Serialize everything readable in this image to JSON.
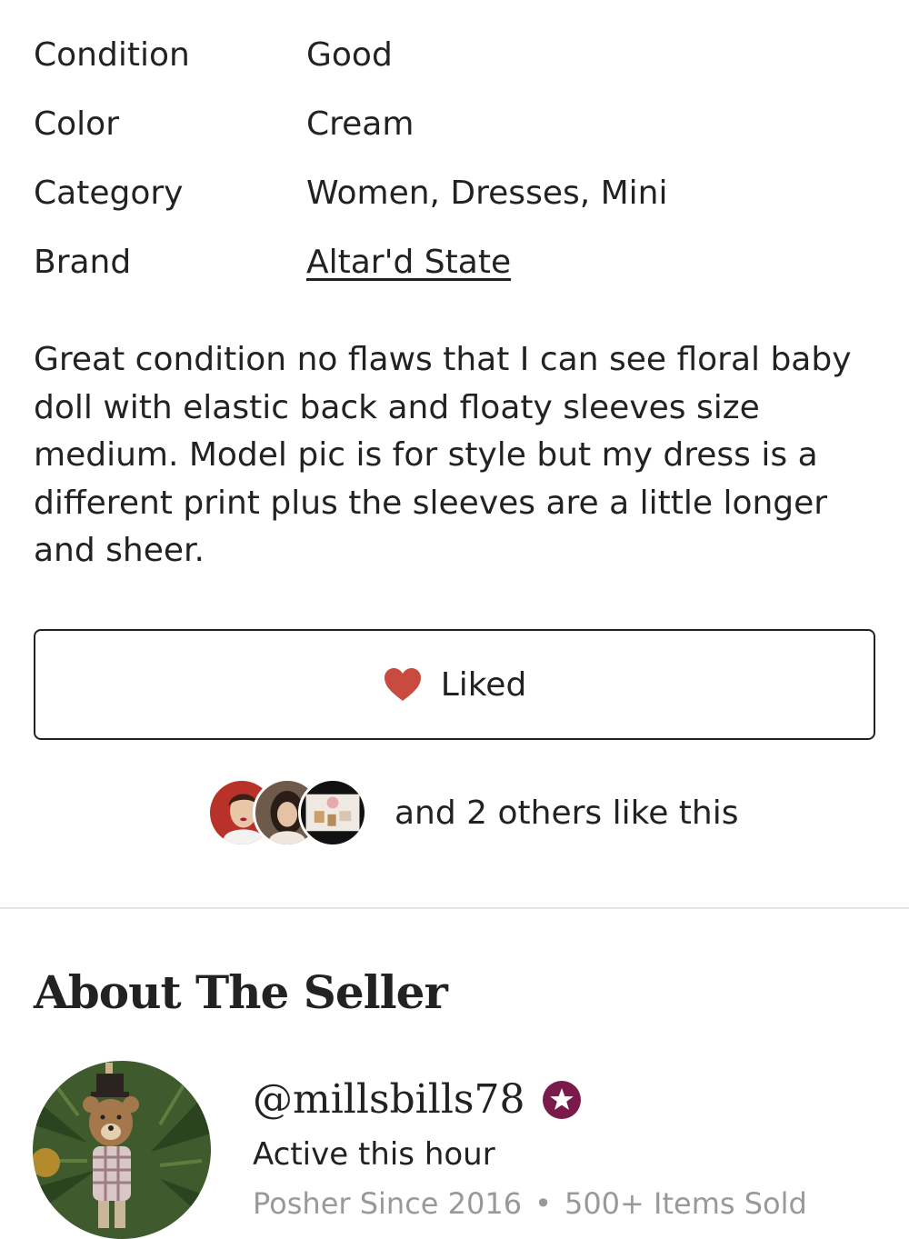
{
  "details": [
    {
      "label": "Condition",
      "value": "Good",
      "is_link": false
    },
    {
      "label": "Color",
      "value": "Cream",
      "is_link": false
    },
    {
      "label": "Category",
      "value": "Women, Dresses, Mini",
      "is_link": false
    },
    {
      "label": "Brand",
      "value": "Altar'd State",
      "is_link": true
    }
  ],
  "description": "Great condition no flaws that I can see floral baby doll with elastic back and floaty sleeves size medium. Model pic is for style but my dress is a different print plus the sleeves are a little longer and sheer.",
  "like_button": {
    "label": "Liked",
    "icon": "heart-icon",
    "heart_color": "#c94a3f"
  },
  "likers": {
    "text": "and 2 others like this"
  },
  "about_seller": {
    "title": "About The Seller",
    "username": "@millsbills78",
    "badge_icon": "star-badge-icon",
    "badge_color": "#7a1a4b",
    "active": "Active this hour",
    "since": "Posher Since 2016",
    "separator": "•",
    "items_sold": "500+ Items Sold"
  }
}
